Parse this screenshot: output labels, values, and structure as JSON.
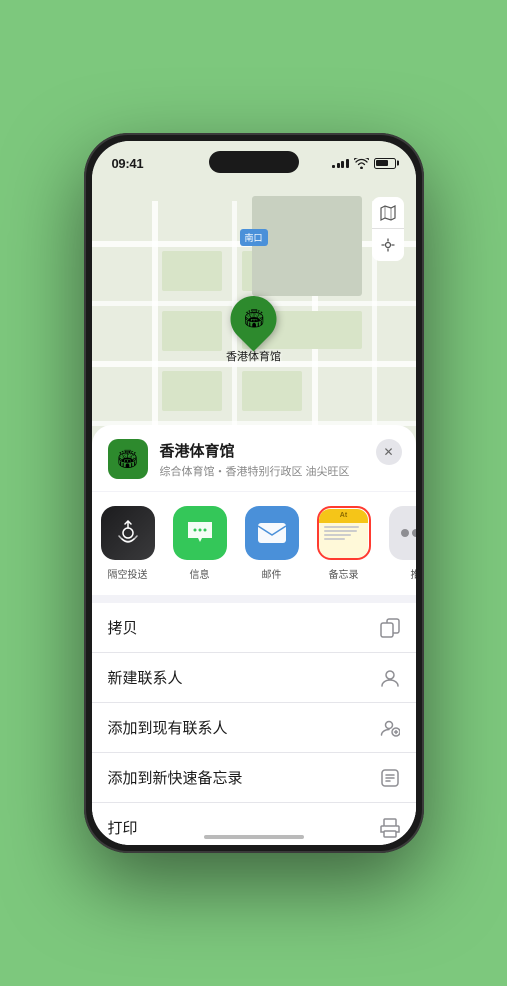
{
  "statusBar": {
    "time": "09:41",
    "location_arrow": "▲"
  },
  "map": {
    "southGateLabel": "南口",
    "venueName": "香港体育馆",
    "mapBtnMap": "🗺",
    "mapBtnLocation": "↗"
  },
  "venueSheet": {
    "name": "香港体育馆",
    "subtitle": "综合体育馆・香港特别行政区 油尖旺区",
    "closeBtn": "✕"
  },
  "shareItems": [
    {
      "id": "airdrop",
      "label": "隔空投送",
      "emoji": "📶"
    },
    {
      "id": "messages",
      "label": "信息",
      "emoji": "💬"
    },
    {
      "id": "mail",
      "label": "邮件",
      "emoji": "✉️"
    },
    {
      "id": "notes",
      "label": "备忘录",
      "emoji": ""
    },
    {
      "id": "more",
      "label": "推",
      "emoji": "⋯"
    }
  ],
  "actionRows": [
    {
      "label": "拷贝",
      "icon": "📋"
    },
    {
      "label": "新建联系人",
      "icon": "👤"
    },
    {
      "label": "添加到现有联系人",
      "icon": "👥"
    },
    {
      "label": "添加到新快速备忘录",
      "icon": "📝"
    },
    {
      "label": "打印",
      "icon": "🖨"
    }
  ]
}
